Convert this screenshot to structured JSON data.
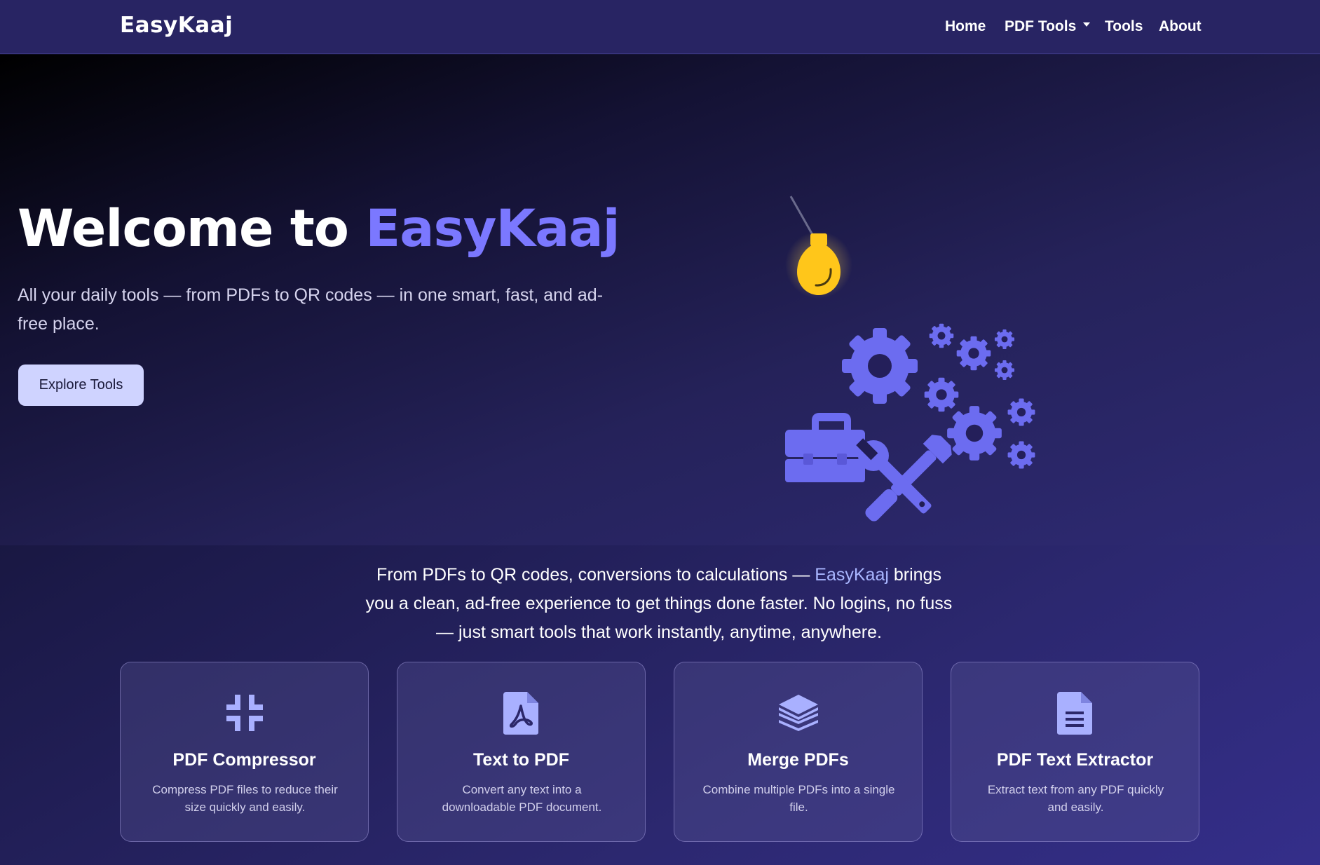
{
  "nav": {
    "brand": "EasyKaaj",
    "links": [
      "Home",
      "PDF Tools",
      "Tools",
      "About"
    ]
  },
  "hero": {
    "title_prefix": "Welcome to",
    "title_accent": "EasyKaaj",
    "subtitle": "All your daily tools — from PDFs to QR codes — in one smart, fast, and ad-free place.",
    "cta_label": "Explore Tools"
  },
  "intro": {
    "text_before": "From PDFs to QR codes, conversions to calculations — ",
    "brand": "EasyKaaj",
    "text_after": " brings you a clean, ad-free experience to get things done faster. No logins, no fuss — just smart tools that work instantly, anytime, anywhere."
  },
  "cards": [
    {
      "icon": "compress-icon",
      "title": "PDF Compressor",
      "description": "Compress PDF files to reduce their size quickly and easily."
    },
    {
      "icon": "pdf-file-icon",
      "title": "Text to PDF",
      "description": "Convert any text into a downloadable PDF document."
    },
    {
      "icon": "layers-icon",
      "title": "Merge PDFs",
      "description": "Combine multiple PDFs into a single file."
    },
    {
      "icon": "file-text-icon",
      "title": "PDF Text Extractor",
      "description": "Extract text from any PDF quickly and easily."
    }
  ],
  "colors": {
    "accent": "#7b78ff",
    "nav_bg": "#282463",
    "icon": "#6c6cf0",
    "card_icon": "#a9b0ff",
    "bulb": "#ffc61a"
  }
}
